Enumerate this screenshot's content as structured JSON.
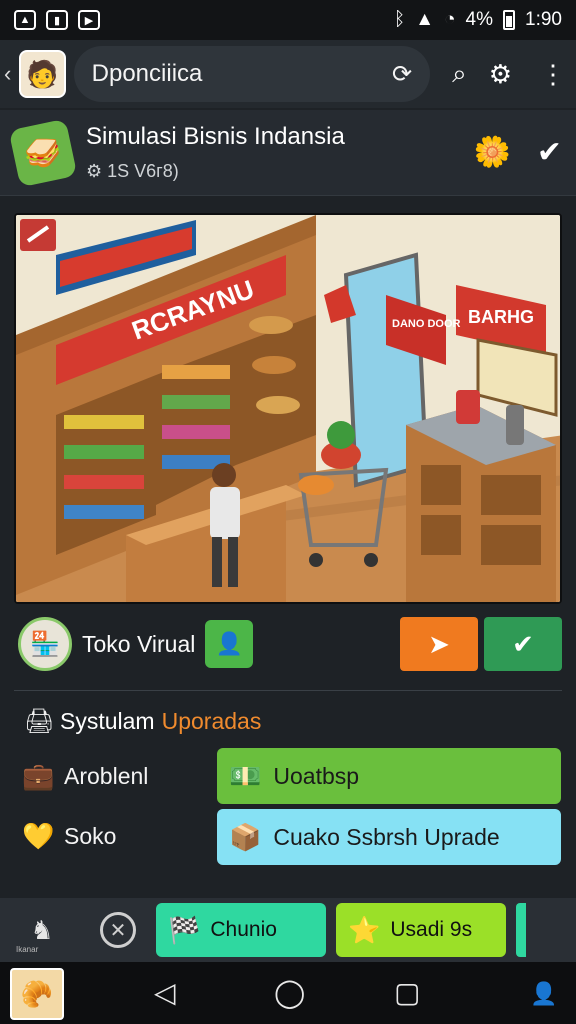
{
  "status_bar": {
    "left_icons": [
      "image-icon",
      "chart-icon",
      "youtube-icon"
    ],
    "right_text": "4%",
    "time": "1:90"
  },
  "app_bar": {
    "back_glyph": "‹",
    "title": "Dponciiica"
  },
  "game_header": {
    "title": "Simulasi Bisnis Indansia",
    "subtitle": "⚙ 1S V6г8)"
  },
  "scene": {
    "top_banner": "",
    "store_sign": "RCRAYNU",
    "wall_sign_1": "BARHG",
    "wall_sign_2": "DANO DOOR"
  },
  "store_row": {
    "label": "Toko Virual"
  },
  "upgrades": {
    "title_part1": "Systulam",
    "title_part2": "Uporadas",
    "rows": [
      {
        "label": "Aroblenl",
        "button": "Uoatbsp"
      },
      {
        "label": "Soko",
        "button": "Cuako Ssbrsh Uprade"
      }
    ]
  },
  "bottom_tabs": {
    "first_label": "Ikanar",
    "teal_button": "Chunio",
    "lime_button": "Usadi 9s"
  },
  "colors": {
    "orange": "#f07a1f",
    "green": "#2f9a55",
    "accent_orange_text": "#f08b2e",
    "green_button": "#6abf3d",
    "cyan_button": "#86e1f4",
    "teal_button": "#2fd8a0",
    "lime_button": "#9be028"
  }
}
